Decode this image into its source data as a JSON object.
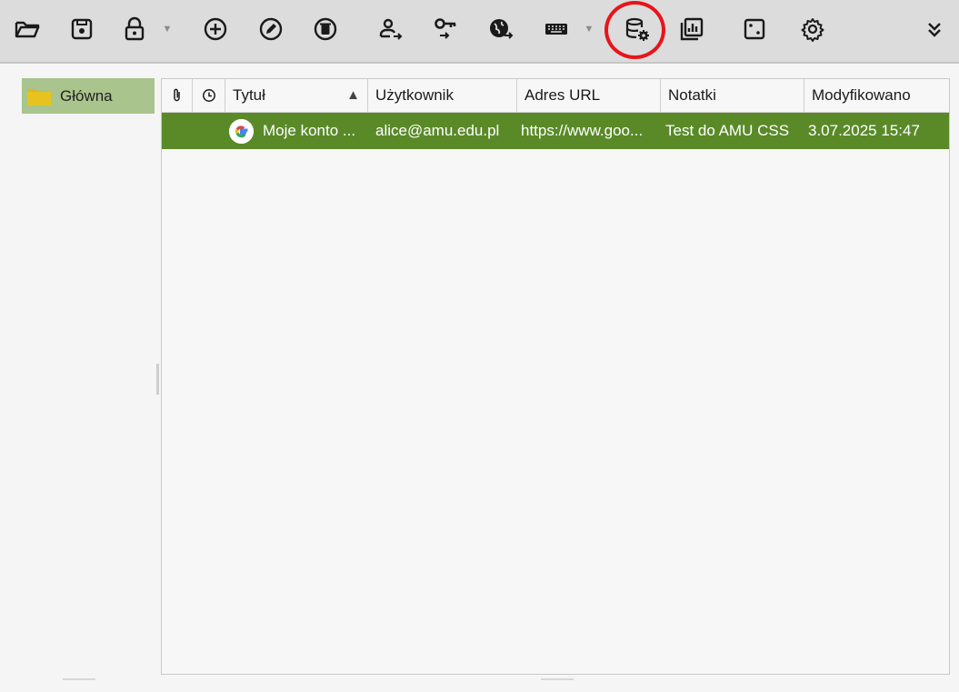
{
  "toolbar": {
    "buttons": [
      {
        "name": "open-database",
        "icon": "folder-open-icon"
      },
      {
        "name": "save-database",
        "icon": "save-icon"
      },
      {
        "name": "lock-database",
        "icon": "lock-icon"
      },
      {
        "name": "add-entry",
        "icon": "plus-circle-icon"
      },
      {
        "name": "edit-entry",
        "icon": "pencil-circle-icon"
      },
      {
        "name": "delete-entry",
        "icon": "trash-circle-icon"
      },
      {
        "name": "copy-username",
        "icon": "user-arrow-icon"
      },
      {
        "name": "copy-password",
        "icon": "key-arrow-icon"
      },
      {
        "name": "copy-url",
        "icon": "globe-arrow-icon"
      },
      {
        "name": "autotype",
        "icon": "keyboard-icon"
      },
      {
        "name": "database-settings",
        "icon": "database-gear-icon"
      },
      {
        "name": "reports",
        "icon": "reports-icon"
      },
      {
        "name": "password-generator",
        "icon": "dice-icon"
      },
      {
        "name": "settings",
        "icon": "gear-icon"
      },
      {
        "name": "more",
        "icon": "chevron-double-down-icon"
      }
    ],
    "highlight_color": "#e8141b"
  },
  "sidebar": {
    "groups": [
      {
        "label": "Główna",
        "icon": "folder-icon",
        "selected": true
      }
    ]
  },
  "table": {
    "columns": [
      {
        "label": "",
        "icon": "paperclip-icon"
      },
      {
        "label": "",
        "icon": "clock-icon"
      },
      {
        "label": "Tytuł",
        "sorted": "asc",
        "sort_glyph": "▲"
      },
      {
        "label": "Użytkownik"
      },
      {
        "label": "Adres URL"
      },
      {
        "label": "Notatki"
      },
      {
        "label": "Modyfikowano"
      }
    ],
    "rows": [
      {
        "icon": "google-icon",
        "title": "Moje konto ...",
        "username": "alice@amu.edu.pl",
        "url": "https://www.goo...",
        "notes": "Test do AMU CSS",
        "modified": "3.07.2025 15:47",
        "selected": true
      }
    ]
  },
  "colors": {
    "selection_row": "#5a8a28",
    "selected_group": "#a9c48c",
    "folder": "#e0b81c"
  }
}
